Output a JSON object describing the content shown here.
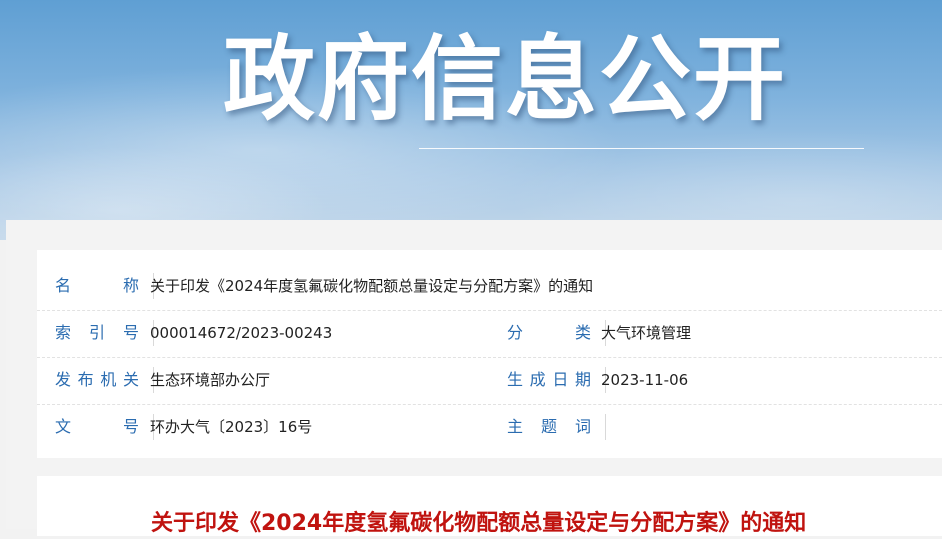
{
  "banner": {
    "title": "政府信息公开"
  },
  "meta": {
    "name_label": "名　　称",
    "name_value": "关于印发《2024年度氢氟碳化物配额总量设定与分配方案》的通知",
    "index_label": "索 引 号",
    "index_value": "000014672/2023-00243",
    "category_label": "分　　类",
    "category_value": "大气环境管理",
    "issuer_label": "发布机关",
    "issuer_value": "生态环境部办公厅",
    "date_label": "生成日期",
    "date_value": "2023-11-06",
    "doc_no_label": "文　　号",
    "doc_no_value": "环办大气〔2023〕16号",
    "keywords_label": "主 题 词",
    "keywords_value": ""
  },
  "content": {
    "title": "关于印发《2024年度氢氟碳化物配额总量设定与分配方案》的通知"
  }
}
